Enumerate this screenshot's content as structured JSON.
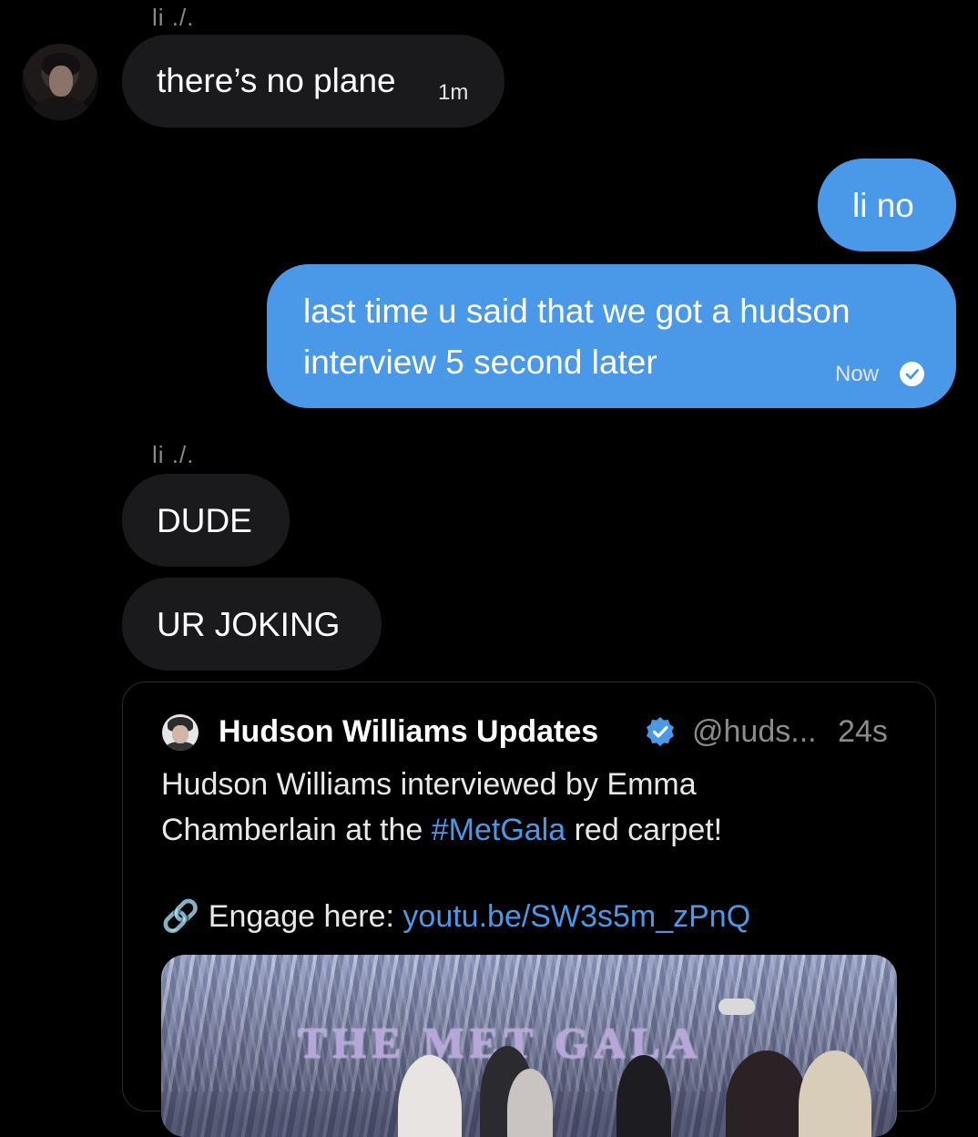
{
  "conversation": {
    "messages": [
      {
        "sender": "li ./.",
        "text": "there’s no plane",
        "time": "1m"
      },
      {
        "text": "li no"
      },
      {
        "text_line1": "last time u said that we got a hudson",
        "text_line2": "interview 5 second later",
        "time": "Now"
      },
      {
        "sender": "li ./.",
        "text": "DUDE"
      },
      {
        "text": "UR JOKING"
      }
    ]
  },
  "tweet": {
    "author_name": "Hudson Williams Updates",
    "handle": "@huds...",
    "time": "24s",
    "line1": "Hudson Williams interviewed by Emma",
    "line2_prefix": "Chamberlain at the ",
    "hashtag": "#MetGala",
    "line2_suffix": " red carpet!",
    "link_icon": "🔗",
    "link_prefix": "Engage here: ",
    "link_url": "youtu.be/SW3s5m_zPnQ",
    "media_text": "THE MET GALA"
  },
  "colors": {
    "background": "#000000",
    "incoming_bubble": "#1a1a1c",
    "outgoing_bubble": "#4a98e8",
    "link": "#4a98e8"
  },
  "icons": {
    "read_receipt": "check-circle-icon",
    "verified": "verified-badge-icon",
    "link": "link-icon"
  }
}
